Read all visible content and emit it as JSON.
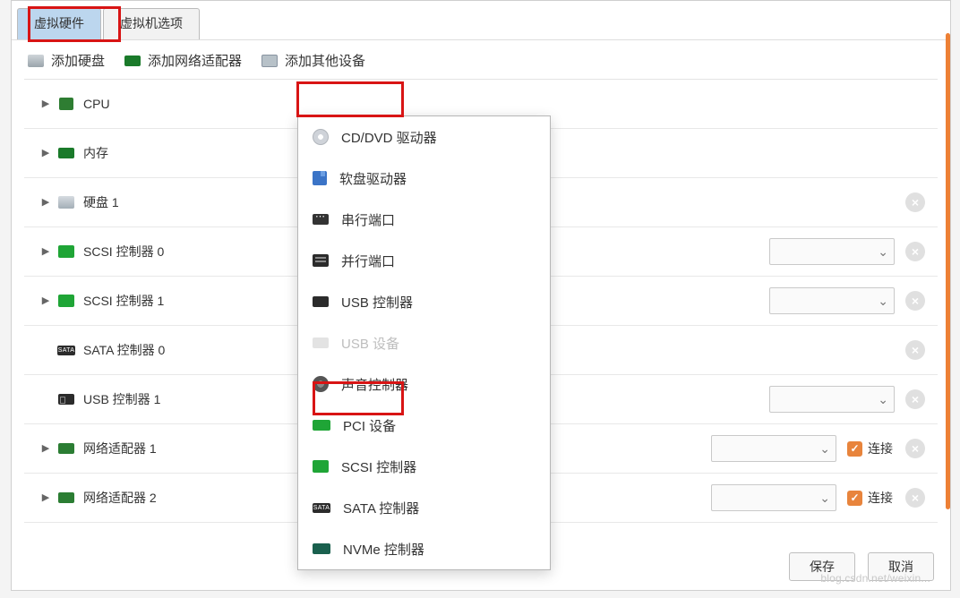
{
  "tabs": {
    "hardware": "虚拟硬件",
    "options": "虚拟机选项"
  },
  "toolbar": {
    "add_disk": "添加硬盘",
    "add_nic": "添加网络适配器",
    "add_other": "添加其他设备"
  },
  "devices": [
    {
      "label": "CPU",
      "icon": "cpu",
      "expandable": true
    },
    {
      "label": "内存",
      "icon": "mem",
      "expandable": true
    },
    {
      "label": "硬盘 1",
      "icon": "hdd",
      "expandable": true,
      "removable": true
    },
    {
      "label": "SCSI 控制器 0",
      "icon": "scsi",
      "expandable": true,
      "dropdown": true,
      "removable": true
    },
    {
      "label": "SCSI 控制器 1",
      "icon": "scsi",
      "expandable": true,
      "dropdown": true,
      "removable": true
    },
    {
      "label": "SATA 控制器 0",
      "icon": "sata",
      "expandable": false,
      "removable": true
    },
    {
      "label": "USB 控制器 1",
      "icon": "usb",
      "expandable": false,
      "dropdown": true,
      "removable": true
    },
    {
      "label": "网络适配器 1",
      "icon": "nic",
      "expandable": true,
      "dropdown": true,
      "checkbox": true,
      "checkbox_label": "连接",
      "removable": true
    },
    {
      "label": "网络适配器 2",
      "icon": "nic",
      "expandable": true,
      "dropdown": true,
      "checkbox": true,
      "checkbox_label": "连接",
      "removable": true
    }
  ],
  "dropdown_menu": [
    {
      "label": "CD/DVD 驱动器",
      "icon": "cd"
    },
    {
      "label": "软盘驱动器",
      "icon": "floppy"
    },
    {
      "label": "串行端口",
      "icon": "serial"
    },
    {
      "label": "并行端口",
      "icon": "parallel"
    },
    {
      "label": "USB 控制器",
      "icon": "usbctl"
    },
    {
      "label": "USB 设备",
      "icon": "usbdev",
      "disabled": true
    },
    {
      "label": "声音控制器",
      "icon": "sound"
    },
    {
      "label": "PCI 设备",
      "icon": "pci"
    },
    {
      "label": "SCSI 控制器",
      "icon": "scsi"
    },
    {
      "label": "SATA 控制器",
      "icon": "sata"
    },
    {
      "label": "NVMe 控制器",
      "icon": "nvme"
    }
  ],
  "sata_badge": "SATA",
  "footer": {
    "save": "保存",
    "cancel": "取消"
  },
  "watermark": "blog.csdn.net/weixin..."
}
